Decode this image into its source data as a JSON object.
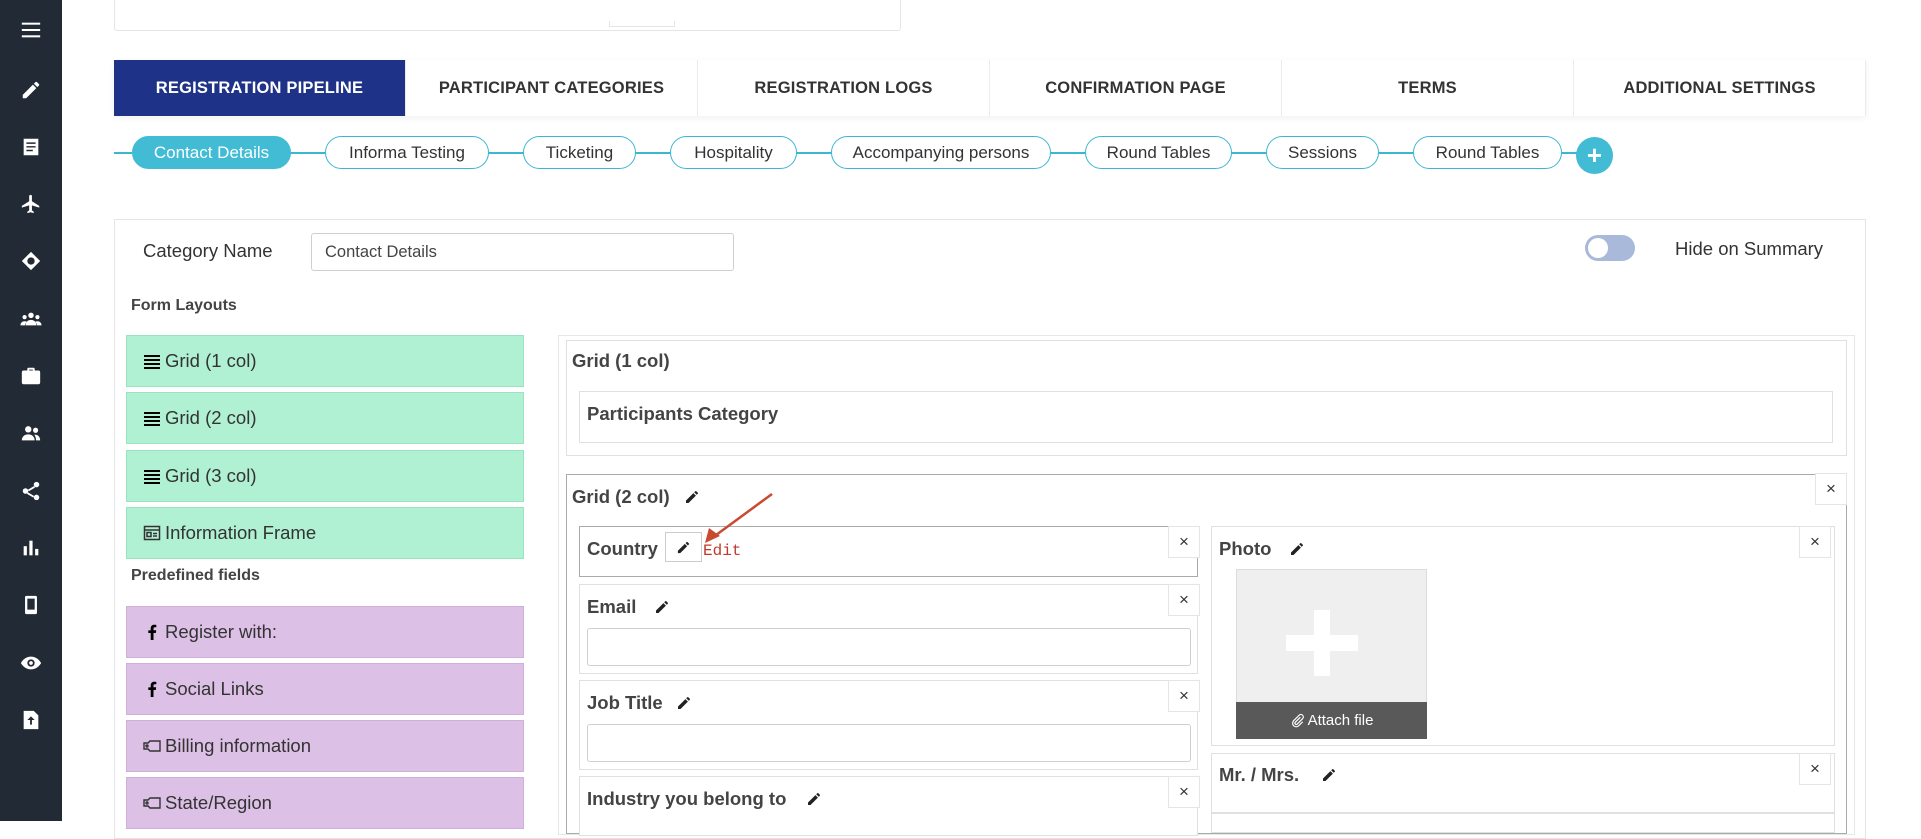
{
  "sidebar": {
    "items": [
      {
        "icon": "menu-icon"
      },
      {
        "icon": "pencil-icon"
      },
      {
        "icon": "document-icon"
      },
      {
        "icon": "airplane-icon"
      },
      {
        "icon": "ticket-icon"
      },
      {
        "icon": "group-icon"
      },
      {
        "icon": "briefcase-icon"
      },
      {
        "icon": "users-icon"
      },
      {
        "icon": "share-icon"
      },
      {
        "icon": "bar-chart-icon"
      },
      {
        "icon": "mobile-icon"
      },
      {
        "icon": "eye-icon"
      },
      {
        "icon": "upload-icon"
      }
    ]
  },
  "tabs": [
    {
      "label": "REGISTRATION PIPELINE",
      "active": true
    },
    {
      "label": "PARTICIPANT CATEGORIES",
      "active": false
    },
    {
      "label": "REGISTRATION LOGS",
      "active": false
    },
    {
      "label": "CONFIRMATION PAGE",
      "active": false
    },
    {
      "label": "TERMS",
      "active": false
    },
    {
      "label": "ADDITIONAL SETTINGS",
      "active": false
    }
  ],
  "pipeline": {
    "steps": [
      {
        "label": "Contact Details",
        "active": true
      },
      {
        "label": "Informa Testing",
        "active": false
      },
      {
        "label": "Ticketing",
        "active": false
      },
      {
        "label": "Hospitality",
        "active": false
      },
      {
        "label": "Accompanying persons",
        "active": false
      },
      {
        "label": "Round Tables",
        "active": false
      },
      {
        "label": "Sessions",
        "active": false
      },
      {
        "label": "Round Tables",
        "active": false
      }
    ],
    "add_symbol": "+"
  },
  "category": {
    "label": "Category Name",
    "value": "Contact Details",
    "hide_label": "Hide on Summary",
    "hide_on_summary": false
  },
  "form_layouts": {
    "title": "Form Layouts",
    "items": [
      {
        "label": "Grid (1 col)",
        "icon": "rows-icon"
      },
      {
        "label": "Grid (2 col)",
        "icon": "rows-icon"
      },
      {
        "label": "Grid (3 col)",
        "icon": "rows-icon"
      },
      {
        "label": "Information Frame",
        "icon": "frame-icon"
      }
    ]
  },
  "predefined_fields": {
    "title": "Predefined fields",
    "items": [
      {
        "label": "Register with:",
        "icon": "facebook-icon"
      },
      {
        "label": "Social Links",
        "icon": "facebook-icon"
      },
      {
        "label": "Billing information",
        "icon": "tag-icon"
      },
      {
        "label": "State/Region",
        "icon": "tag-icon"
      }
    ]
  },
  "canvas": {
    "grid1": {
      "title": "Grid (1 col)",
      "field": "Participants Category"
    },
    "grid2": {
      "title": "Grid (2 col)",
      "close": "×",
      "left_fields": [
        {
          "label": "Country",
          "hint": "Edit"
        },
        {
          "label": "Email"
        },
        {
          "label": "Job Title"
        },
        {
          "label": "Industry you belong to"
        }
      ],
      "right_fields": [
        {
          "label": "Photo",
          "attach": "Attach file"
        },
        {
          "label": "Mr. / Mrs."
        }
      ]
    }
  },
  "colors": {
    "sidebar": "#222a35",
    "active_tab": "#1e3387",
    "pipeline_accent": "#41bcd4",
    "layout_green": "#b0f0d3",
    "field_purple": "#dcc0e5",
    "hint_red": "#c0392b"
  }
}
